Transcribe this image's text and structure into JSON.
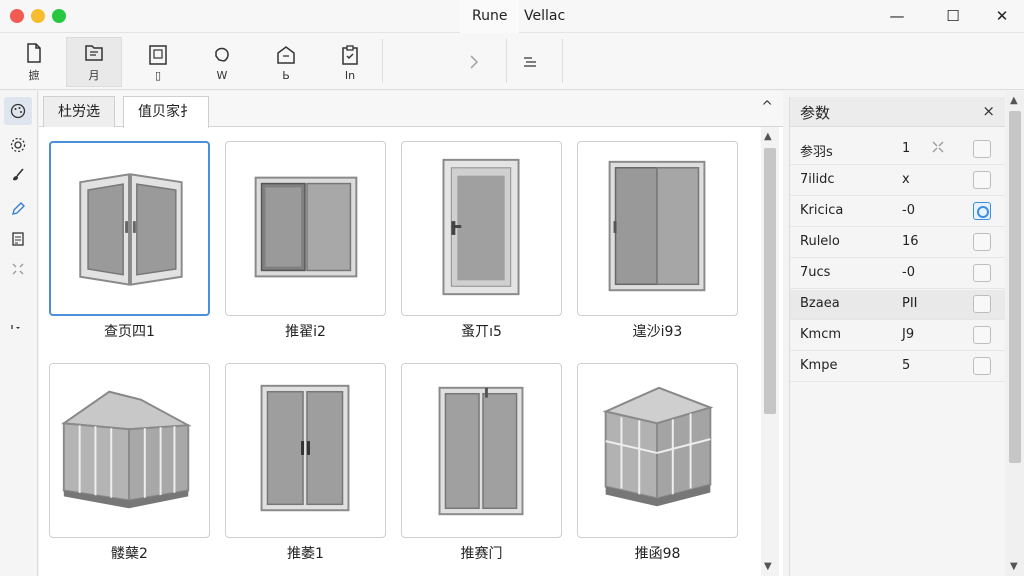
{
  "window": {
    "tabs": [
      {
        "label": "Rune",
        "active": true
      },
      {
        "label": "Vellac",
        "active": false
      }
    ],
    "controls": {
      "minimize": "—",
      "maximize": "☐",
      "close": "✕"
    }
  },
  "ribbon": {
    "buttons": [
      {
        "label": "摭",
        "icon": "new-file-icon",
        "selected": false
      },
      {
        "label": "月",
        "icon": "folder-open-icon",
        "selected": true
      },
      {
        "label": "▯",
        "icon": "frame-icon",
        "selected": false
      },
      {
        "label": "W",
        "icon": "hand-icon",
        "selected": false
      },
      {
        "label": "Ь",
        "icon": "house-icon",
        "selected": false
      },
      {
        "label": "In",
        "icon": "clipboard-check-icon",
        "selected": false
      }
    ]
  },
  "left_toolbar": {
    "items": [
      {
        "icon": "palette-icon",
        "selected": true
      },
      {
        "icon": "gear-icon",
        "selected": false
      },
      {
        "icon": "brush-icon",
        "selected": false
      },
      {
        "icon": "pencil-icon",
        "selected": false
      },
      {
        "icon": "document-icon",
        "selected": false
      },
      {
        "icon": "arrows-icon",
        "selected": false
      },
      {
        "icon": "more-icon",
        "selected": false
      }
    ]
  },
  "library": {
    "tabs": [
      {
        "label": "杜労选",
        "active": false
      },
      {
        "label": "值贝家扌",
        "active": true
      }
    ],
    "collapse": "^",
    "items": [
      {
        "caption": "查页四1",
        "kind": "casement-window",
        "selected": true
      },
      {
        "caption": "推翟i2",
        "kind": "sliding-window",
        "selected": false
      },
      {
        "caption": "蚤丌ı5",
        "kind": "single-door",
        "selected": false
      },
      {
        "caption": "遑沙i93",
        "kind": "sliding-door",
        "selected": false
      },
      {
        "caption": "髅蘖2",
        "kind": "sunroom",
        "selected": false
      },
      {
        "caption": "推萎1",
        "kind": "double-door",
        "selected": false
      },
      {
        "caption": "推赛门",
        "kind": "double-door-tall",
        "selected": false
      },
      {
        "caption": "推函98",
        "kind": "sunroom-corner",
        "selected": false
      }
    ]
  },
  "properties": {
    "title": "参数",
    "close": "×",
    "rows": [
      {
        "name": "参羽s",
        "value": "1",
        "checked": false,
        "highlight": false
      },
      {
        "name": "7ilidc",
        "value": "x",
        "checked": false,
        "highlight": false
      },
      {
        "name": "Kricica",
        "value": "-0",
        "checked": true,
        "highlight": false
      },
      {
        "name": "Rulelo",
        "value": "16",
        "checked": false,
        "highlight": false
      },
      {
        "name": "7ucs",
        "value": "-0",
        "checked": false,
        "highlight": false
      },
      {
        "name": "Bzaea",
        "value": "PII",
        "checked": false,
        "highlight": true
      },
      {
        "name": "Kmcm",
        "value": "J9",
        "checked": false,
        "highlight": false
      },
      {
        "name": "Kmpe",
        "value": "5",
        "checked": false,
        "highlight": false
      }
    ]
  },
  "colors": {
    "accent": "#4a90d9",
    "frame": "#8a8a8a",
    "glass": "#9a9a9a"
  }
}
